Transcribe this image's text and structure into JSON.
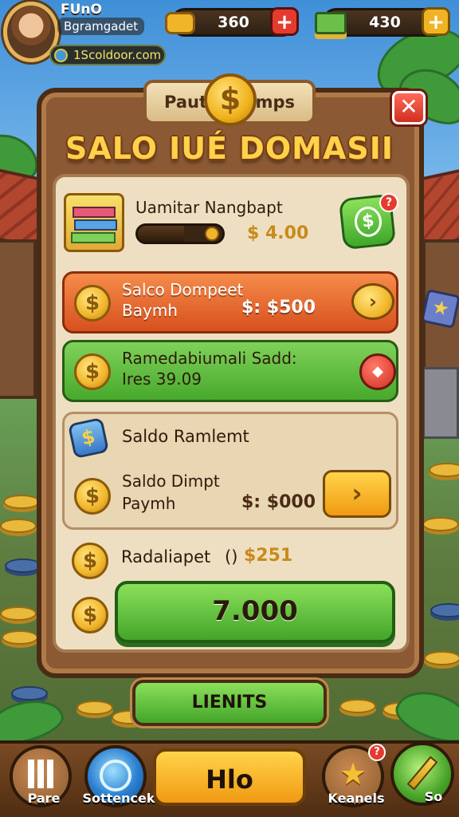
{
  "player": {
    "name": "FUnO",
    "subtitle": "Bgramgadet",
    "website": "1Scoldoor.com"
  },
  "resources": [
    {
      "icon": "coin-stack-icon",
      "value": "360",
      "button": "+",
      "button_color": "#e53b2f"
    },
    {
      "icon": "cash-stack-icon",
      "value": "430",
      "button": "+",
      "button_color": "#f0b323"
    }
  ],
  "dialog": {
    "ribbon_left": "Paut",
    "ribbon_right": "Dmps",
    "title": "SALO IUÉ DOMASII",
    "close_label": "✕",
    "upgrade": {
      "title": "Uamitar Nangbapt",
      "amount": "$ 4.00",
      "progress_fraction": 0.55,
      "button_icon": "dollar-icon",
      "badge": "?"
    },
    "rows": [
      {
        "title": "Salco Dompeet",
        "sub": "Baymh",
        "amount": "$: $500",
        "button": "›",
        "style": "orange"
      },
      {
        "title": "Ramedabiumali Sadd:",
        "sub": "Ires 39.09",
        "amount": "",
        "button": "◆",
        "style": "green"
      }
    ],
    "card": {
      "heading": "Saldo Ramlemt",
      "title": "Saldo Dimpt",
      "sub": "Paymh",
      "amount": "$: $000",
      "button": "›"
    },
    "total_row": {
      "label": "Radaliapet",
      "marker": "()",
      "amount": "$251"
    },
    "main_button": "7.000",
    "sub_button": "LIENITS"
  },
  "bottom_nav": [
    {
      "label": "Pare",
      "icon": "pause-icon"
    },
    {
      "label": "Sottencek",
      "icon": "orb-icon"
    },
    {
      "label": "Hlo",
      "icon": ""
    },
    {
      "label": "Keanels",
      "icon": "star-icon",
      "badge": "?"
    },
    {
      "label": "So",
      "icon": "pencil-icon"
    }
  ],
  "colors": {
    "orange_row": "#e8622a",
    "green_row": "#5bbf3a",
    "gold": "#f1b52a",
    "wood": "#8b5a34"
  }
}
